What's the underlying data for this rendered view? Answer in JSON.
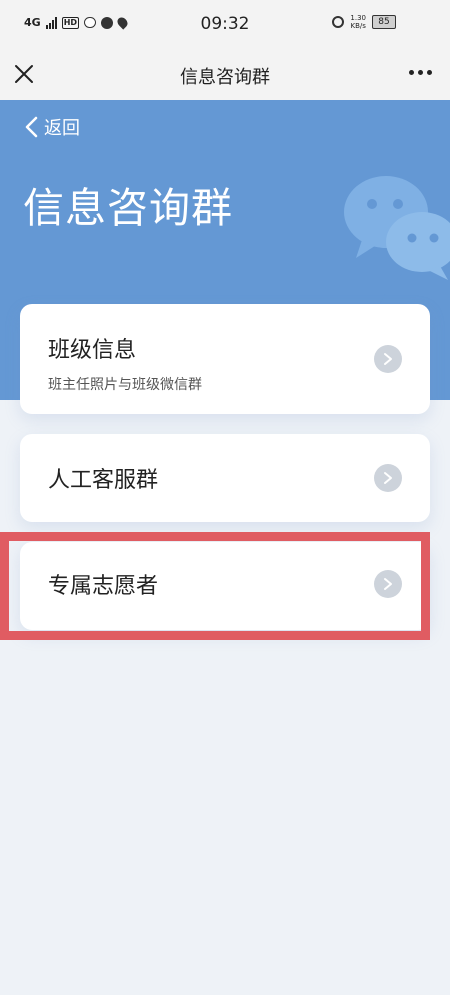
{
  "status": {
    "network": "4G",
    "hd": "HD",
    "time": "09:32",
    "speed_value": "1.30",
    "speed_unit": "KB/s",
    "battery": "85"
  },
  "navbar": {
    "title": "信息咨询群",
    "close_icon": "close-icon",
    "more_icon": "more-icon"
  },
  "hero": {
    "back_label": "返回",
    "title": "信息咨询群",
    "color": "#6498d4"
  },
  "cards": [
    {
      "title": "班级信息",
      "subtitle": "班主任照片与班级微信群"
    },
    {
      "title": "人工客服群"
    },
    {
      "title": "专属志愿者"
    }
  ],
  "colors": {
    "highlight": "#e05c62",
    "background": "#eef2f7",
    "arrow_bg": "#cdd3db"
  }
}
